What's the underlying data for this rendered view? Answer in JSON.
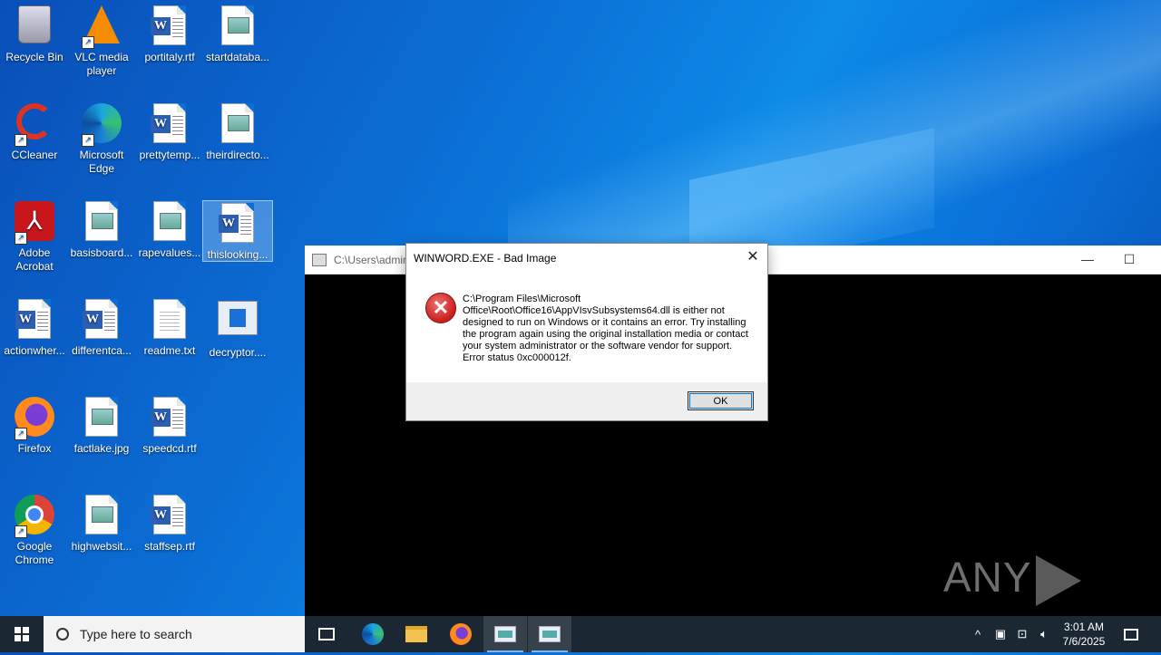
{
  "desktop": {
    "icons": [
      {
        "label": "Recycle Bin"
      },
      {
        "label": "VLC media player"
      },
      {
        "label": "portitaly.rtf"
      },
      {
        "label": "startdataba..."
      },
      {
        "label": "CCleaner"
      },
      {
        "label": "Microsoft Edge"
      },
      {
        "label": "prettytemp..."
      },
      {
        "label": "theirdirecto..."
      },
      {
        "label": "Adobe Acrobat"
      },
      {
        "label": "basisboard..."
      },
      {
        "label": "rapevalues..."
      },
      {
        "label": "thislooking..."
      },
      {
        "label": "actionwher..."
      },
      {
        "label": "differentca..."
      },
      {
        "label": "readme.txt"
      },
      {
        "label": "decryptor...."
      },
      {
        "label": "Firefox"
      },
      {
        "label": "factlake.jpg"
      },
      {
        "label": "speedcd.rtf"
      },
      {
        "label": "Google Chrome"
      },
      {
        "label": "highwebsit..."
      },
      {
        "label": "staffsep.rtf"
      }
    ]
  },
  "console": {
    "title": "C:\\Users\\admin",
    "minimize": "—",
    "maximize": "☐"
  },
  "dialog": {
    "title": "WINWORD.EXE - Bad Image",
    "close": "✕",
    "icon": "error-icon",
    "message": "C:\\Program Files\\Microsoft Office\\Root\\Office16\\AppVIsvSubsystems64.dll is either not designed to run on Windows or it contains an error. Try installing the program again using the original installation media or contact your system administrator or the software vendor for support. Error status 0xc000012f.",
    "ok_label": "OK"
  },
  "watermark": {
    "left": "ANY",
    "right": "RUN"
  },
  "taskbar": {
    "search_placeholder": "Type here to search",
    "tray_up": "^",
    "time": "3:01 AM",
    "date": "7/6/2025"
  }
}
